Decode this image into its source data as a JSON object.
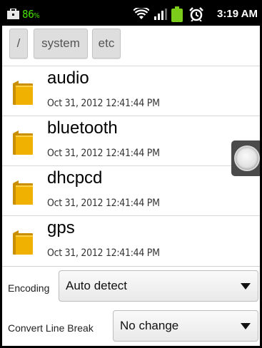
{
  "status_bar": {
    "battery_percent": "86",
    "battery_unit": "%",
    "time": "3:19 AM",
    "icons": [
      "briefcase-icon",
      "wifi-icon",
      "signal-icon",
      "android-battery-icon",
      "alarm-clock-icon"
    ],
    "colors": {
      "battery_text": "#46e000",
      "android_icon": "#7ccc1c"
    }
  },
  "breadcrumb": {
    "items": [
      "/",
      "system",
      "etc"
    ]
  },
  "file_list": {
    "items": [
      {
        "name": "audio",
        "date": "Oct 31, 2012 12:41:44 PM",
        "icon": "folder-icon"
      },
      {
        "name": "bluetooth",
        "date": "Oct 31, 2012 12:41:44 PM",
        "icon": "folder-icon"
      },
      {
        "name": "dhcpcd",
        "date": "Oct 31, 2012 12:41:44 PM",
        "icon": "folder-icon"
      },
      {
        "name": "gps",
        "date": "Oct 31, 2012 12:41:44 PM",
        "icon": "folder-icon"
      }
    ]
  },
  "settings": {
    "encoding_label": "Encoding",
    "encoding_value": "Auto detect",
    "linebreak_label": "Convert Line Break",
    "linebreak_value": "No change"
  },
  "colors": {
    "folder": "#f0b100",
    "folder_dark": "#c98f00"
  }
}
